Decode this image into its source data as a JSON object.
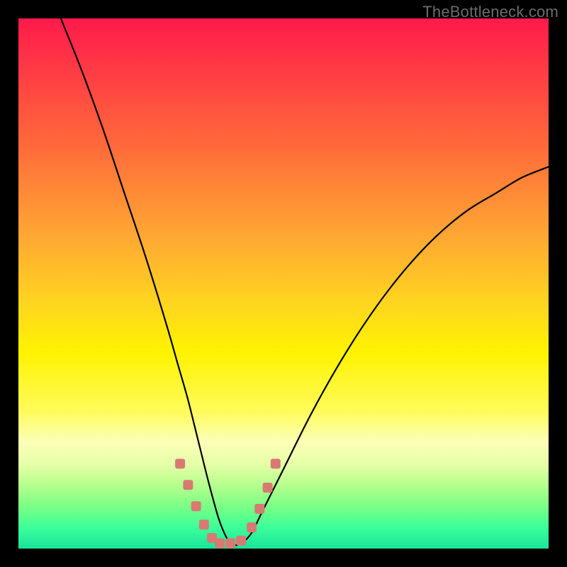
{
  "watermark": "TheBottleneck.com",
  "colors": {
    "page_bg": "#000000",
    "watermark_text": "#6b6b6b",
    "curve_stroke": "#000000",
    "marker_fill": "#d87a72",
    "gradient_stops": [
      "#ff1a4b",
      "#ff3546",
      "#ff6a3a",
      "#ffa733",
      "#ffd61f",
      "#fff300",
      "#fffb5a",
      "#fcffb8",
      "#e6ffa8",
      "#b7ff8e",
      "#7bff85",
      "#3dff9a",
      "#18e59a"
    ]
  },
  "chart_data": {
    "type": "line",
    "title": "",
    "xlabel": "",
    "ylabel": "",
    "xlim": [
      0,
      100
    ],
    "ylim": [
      0,
      100
    ],
    "note": "Values estimated from pixels; x and y are percentages of the plot area (0 at left/bottom, 100 at right/top). The curve descends steeply from top-left to a flat minimum near x≈37-43 then rises toward the right.",
    "series": [
      {
        "name": "curve",
        "x": [
          8,
          12,
          16,
          20,
          24,
          28,
          30,
          32,
          34,
          36,
          38,
          40,
          42,
          44,
          46,
          50,
          55,
          60,
          65,
          70,
          75,
          80,
          85,
          90,
          95,
          100
        ],
        "y": [
          100,
          90,
          79,
          67,
          55,
          42,
          35,
          28,
          20,
          12,
          5,
          1,
          1,
          3,
          7,
          15,
          25,
          34,
          42,
          49,
          55,
          60,
          64,
          67,
          70,
          72
        ]
      }
    ],
    "markers": {
      "name": "highlighted-points",
      "x": [
        30.5,
        32.0,
        33.5,
        35.0,
        36.5,
        38.0,
        40.0,
        42.0,
        44.0,
        45.5,
        47.0,
        48.5
      ],
      "y": [
        16.0,
        12.0,
        8.0,
        4.5,
        2.0,
        1.0,
        1.0,
        1.5,
        4.0,
        7.5,
        11.5,
        16.0
      ]
    }
  }
}
